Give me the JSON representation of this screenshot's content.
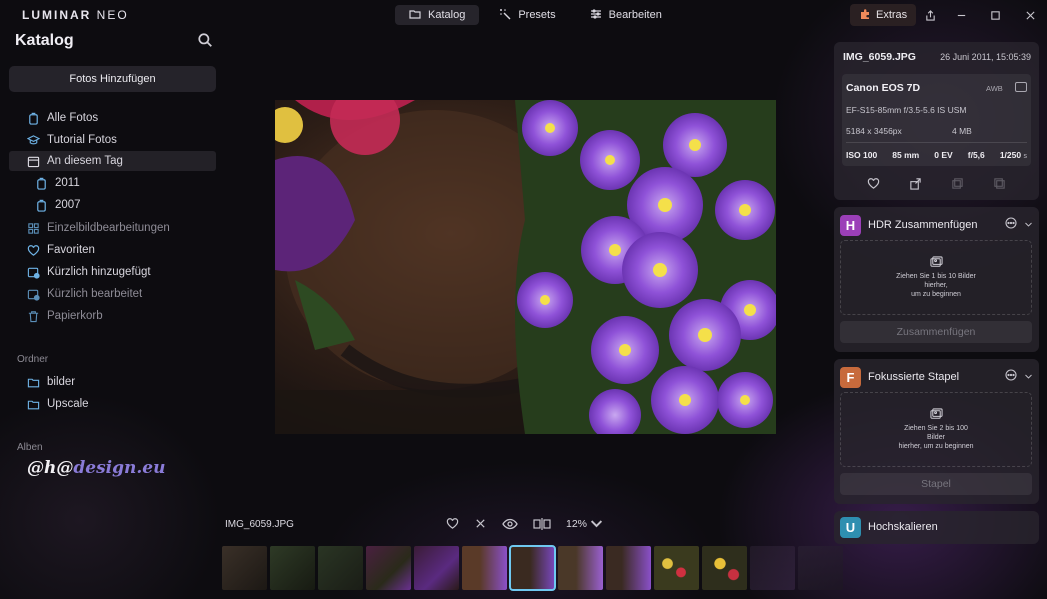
{
  "app": {
    "logo_main": "LUMINAR",
    "logo_sub": "NEO"
  },
  "topnav": {
    "tabs": [
      {
        "label": "Katalog",
        "icon": "folder-icon",
        "active": true
      },
      {
        "label": "Presets",
        "icon": "sparkle-icon",
        "active": false
      },
      {
        "label": "Bearbeiten",
        "icon": "sliders-icon",
        "active": false
      }
    ],
    "extras_label": "Extras"
  },
  "sidebar": {
    "title": "Katalog",
    "add_photos_label": "Fotos Hinzufügen",
    "items": [
      {
        "label": "Alle Fotos",
        "icon": "photos-icon"
      },
      {
        "label": "Tutorial Fotos",
        "icon": "graduation-cap-icon"
      },
      {
        "label": "An diesem Tag",
        "icon": "calendar-icon"
      },
      {
        "label": "2011",
        "icon": "photos-icon"
      },
      {
        "label": "2007",
        "icon": "photos-icon"
      },
      {
        "label": "Einzelbildbearbeitungen",
        "icon": "grid-icon"
      },
      {
        "label": "Favoriten",
        "icon": "heart-icon"
      },
      {
        "label": "Kürzlich hinzugefügt",
        "icon": "recent-added-icon"
      },
      {
        "label": "Kürzlich bearbeitet",
        "icon": "recent-edited-icon"
      },
      {
        "label": "Papierkorb",
        "icon": "trash-icon"
      }
    ],
    "folders_label": "Ordner",
    "folders": [
      {
        "label": "bilder",
        "icon": "folder-icon"
      },
      {
        "label": "Upscale",
        "icon": "folder-icon"
      }
    ],
    "albums_label": "Alben",
    "watermark_a": "@h@",
    "watermark_b": "design.eu"
  },
  "viewer": {
    "filename": "IMG_6059.JPG",
    "zoom": "12%"
  },
  "info": {
    "filename": "IMG_6059.JPG",
    "date": "26 Juni 2011, 15:05:39",
    "camera": "Canon EOS 7D",
    "wb": "AWB",
    "lens": "EF-S15-85mm f/3.5-5.6 IS USM",
    "resolution": "5184 x 3456px",
    "filesize": "4 MB",
    "iso": "ISO 100",
    "focal": "85 mm",
    "ev": "0 EV",
    "aperture": "f/5,6",
    "shutter": "1/250",
    "shutter_unit": "s"
  },
  "tools": {
    "hdr": {
      "badge": "H",
      "badge_color": "#9b3fb8",
      "name": "HDR Zusammenfügen",
      "drop_line1": "Ziehen Sie 1 bis 10 Bilder",
      "drop_line2": "hierher,",
      "drop_line3": "um zu beginnen",
      "button": "Zusammenfügen"
    },
    "focus": {
      "badge": "F",
      "badge_color": "#c76a3c",
      "name": "Fokussierte Stapel",
      "drop_line1": "Ziehen Sie 2 bis 100",
      "drop_line2": "Bilder",
      "drop_line3": "hierher, um zu beginnen",
      "button": "Stapel"
    },
    "upscale": {
      "badge": "U",
      "badge_color": "#2e8fb0",
      "name": "Hochskalieren"
    }
  }
}
